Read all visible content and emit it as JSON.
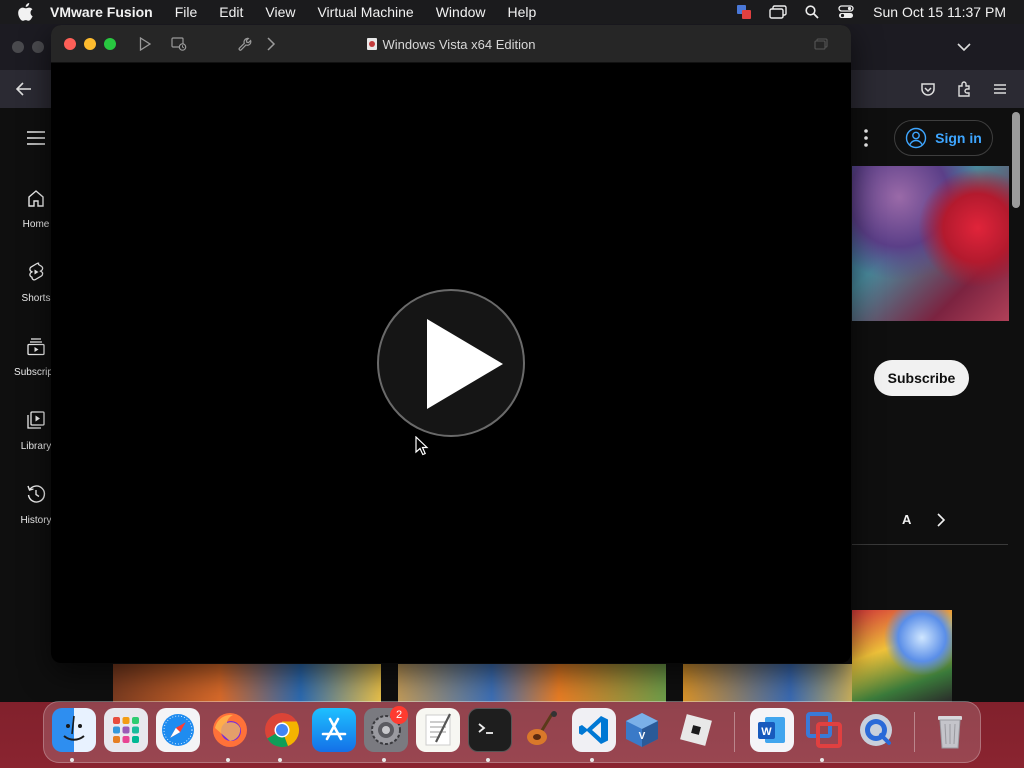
{
  "menubar": {
    "app_name": "VMware Fusion",
    "menus": [
      "File",
      "Edit",
      "View",
      "Virtual Machine",
      "Window",
      "Help"
    ],
    "clock": "Sun Oct 15  11:37 PM",
    "status_icons": [
      "screen-share-icon",
      "window-stack-icon",
      "spotlight-search-icon",
      "control-center-icon"
    ]
  },
  "vmware_window": {
    "title": "Windows Vista x64 Edition",
    "toolbar_icons": [
      "play-icon",
      "snapshot-icon",
      "settings-wrench-icon",
      "chevron-right-icon",
      "fullscreen-icon"
    ],
    "center_icon": "play-icon"
  },
  "youtube": {
    "rail_items": [
      {
        "label": "Home",
        "icon": "home-icon"
      },
      {
        "label": "Shorts",
        "icon": "shorts-icon"
      },
      {
        "label": "Subscripti",
        "icon": "subscriptions-icon"
      },
      {
        "label": "Library",
        "icon": "library-icon"
      },
      {
        "label": "History",
        "icon": "history-icon"
      }
    ],
    "sign_in_label": "Sign in",
    "subscribe_label": "Subscribe",
    "chip_label": "A",
    "accent_color": "#3ea6ff"
  },
  "dock": {
    "apps": [
      {
        "name": "Finder",
        "icon": "finder-icon"
      },
      {
        "name": "Launchpad",
        "icon": "launchpad-icon"
      },
      {
        "name": "Safari",
        "icon": "safari-icon"
      },
      {
        "name": "Firefox",
        "icon": "firefox-icon"
      },
      {
        "name": "Chrome",
        "icon": "chrome-icon"
      },
      {
        "name": "App Store",
        "icon": "app-store-icon"
      },
      {
        "name": "System Settings",
        "icon": "system-settings-icon"
      },
      {
        "name": "TextEdit",
        "icon": "textedit-icon"
      },
      {
        "name": "Terminal",
        "icon": "terminal-icon"
      },
      {
        "name": "GarageBand",
        "icon": "garageband-icon"
      },
      {
        "name": "VS Code",
        "icon": "vscode-icon"
      },
      {
        "name": "VirtualBox",
        "icon": "virtualbox-icon"
      },
      {
        "name": "Roblox",
        "icon": "roblox-icon"
      },
      {
        "name": "Word",
        "icon": "word-icon"
      },
      {
        "name": "VMware Fusion",
        "icon": "vmware-fusion-icon"
      },
      {
        "name": "QuickTime",
        "icon": "quicktime-icon"
      },
      {
        "name": "Trash",
        "icon": "trash-icon"
      }
    ],
    "settings_badge": "2"
  }
}
